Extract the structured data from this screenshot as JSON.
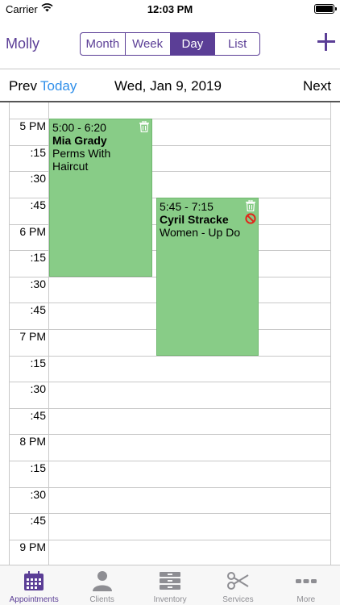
{
  "status": {
    "carrier": "Carrier",
    "time": "12:03 PM"
  },
  "nav": {
    "user": "Molly",
    "views": [
      "Month",
      "Week",
      "Day",
      "List"
    ],
    "active_view": "Day"
  },
  "datebar": {
    "prev": "Prev",
    "today": "Today",
    "date": "Wed, Jan 9, 2019",
    "next": "Next"
  },
  "time_labels": [
    "5 PM",
    ":15",
    ":30",
    ":45",
    "6 PM",
    ":15",
    ":30",
    ":45",
    "7 PM",
    ":15",
    ":30",
    ":45",
    "8 PM",
    ":15",
    ":30",
    ":45",
    "9 PM"
  ],
  "appointments": [
    {
      "time": "5:00 - 6:20",
      "client": "Mia Grady",
      "service": "Perms With Haircut"
    },
    {
      "time": "5:45 - 7:15",
      "client": "Cyril Stracke",
      "service": "Women - Up Do"
    }
  ],
  "tabs": [
    {
      "label": "Appointments",
      "icon": "calendar-icon",
      "active": true
    },
    {
      "label": "Clients",
      "icon": "person-icon",
      "active": false
    },
    {
      "label": "Inventory",
      "icon": "inventory-icon",
      "active": false
    },
    {
      "label": "Services",
      "icon": "scissors-icon",
      "active": false
    },
    {
      "label": "More",
      "icon": "more-icon",
      "active": false
    }
  ],
  "colors": {
    "accent": "#5b3e96",
    "link": "#2f8fea",
    "appointment": "#88cc87"
  }
}
